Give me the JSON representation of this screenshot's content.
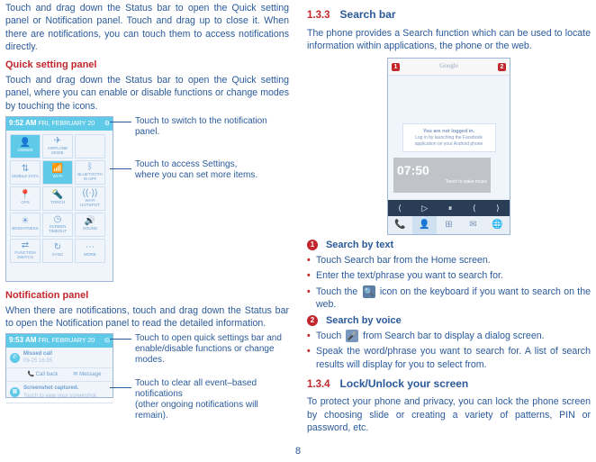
{
  "pageNumber": "8",
  "left": {
    "intro": "Touch and drag down the Status bar to open the Quick setting panel or Notification panel. Touch and drag up to close it. When there are notifications, you can touch them to access notifications directly.",
    "quickSetting": {
      "heading": "Quick setting panel",
      "para": "Touch and drag down the Status bar to open the Quick setting panel, where you can enable or disable functions or change modes by touching the icons.",
      "phone": {
        "time": "9:52 AM",
        "date": "FRI, FEBRUARY 20",
        "tiles": [
          [
            "OWNER",
            "AIRPLANE MODE",
            ""
          ],
          [
            "MOBILE DATA",
            "WI-FI",
            "BLUETOOTH IS OFF"
          ],
          [
            "GPS",
            "TORCH",
            "WI-FI HOTSPOT"
          ],
          [
            "BRIGHTNESS",
            "SCREEN TIMEOUT",
            "SOUND"
          ],
          [
            "FUNCTION SWITCH",
            "SYNC",
            "MORE"
          ]
        ]
      },
      "callout1": "Touch to switch to the notification panel.",
      "callout2a": "Touch to access Settings,",
      "callout2b": "where you can set more items."
    },
    "notifPanel": {
      "heading": "Notification panel",
      "para": "When there are notifications, touch and drag down the Status bar to open the Notification panel to read the detailed information.",
      "phone": {
        "time": "9:53 AM",
        "date": "FRI, FEBRUARY 20",
        "items": {
          "missed": "Missed call",
          "callback": "Call back",
          "message": "Message",
          "screenshot": "Screenshot captured.",
          "screenshotSub": "Touch to view your screenshot."
        }
      },
      "callout1a": "Touch to open quick settings bar and",
      "callout1b": "enable/disable functions or change modes.",
      "callout2a": "Touch to clear all event–based notifications",
      "callout2b": "(other ongoing notifications will remain)."
    }
  },
  "right": {
    "sec133": {
      "num": "1.3.3",
      "title": "Search bar",
      "para": "The phone provides a Search function which can be used to locate information within applications, the phone or the web.",
      "phone": {
        "brand": "Google",
        "cardTitle": "You are not logged in.",
        "cardBody": "Log in by launching the Facebook application on your Android phone",
        "clock": "07:50",
        "unlock": "Touch to wake music"
      },
      "tags": {
        "t1": "1",
        "t2": "2"
      },
      "sbt": {
        "heading": "Search by text",
        "b1": "Touch Search bar from the Home screen.",
        "b2": "Enter the text/phrase you want to search for.",
        "b3a": "Touch the ",
        "b3b": " icon on the keyboard if you want to search on the web."
      },
      "sbv": {
        "heading": "Search by voice",
        "b1a": "Touch ",
        "b1b": " from Search bar to display a dialog screen.",
        "b2": "Speak the word/phrase you want to search for.  A list of search results will display for you to select from."
      }
    },
    "sec134": {
      "num": "1.3.4",
      "title": "Lock/Unlock your screen",
      "para": "To protect your phone and privacy, you can lock the phone screen by choosing slide or creating a variety of patterns, PIN or password, etc."
    }
  }
}
